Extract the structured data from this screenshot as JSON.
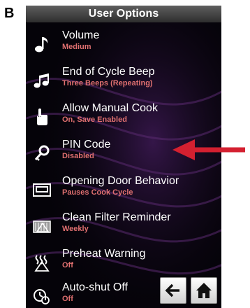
{
  "panel": {
    "letter": "B"
  },
  "header": {
    "title": "User Options"
  },
  "options": [
    {
      "label": "Volume",
      "value": "Medium",
      "icon": "music-note-icon"
    },
    {
      "label": "End of Cycle Beep",
      "value": "Three Beeps (Repeating)",
      "icon": "double-note-icon"
    },
    {
      "label": "Allow Manual Cook",
      "value": "On, Save Enabled",
      "icon": "hand-pointer-icon"
    },
    {
      "label": "PIN Code",
      "value": "Disabled",
      "icon": "key-icon"
    },
    {
      "label": "Opening Door Behavior",
      "value": "Pauses Cook Cycle",
      "icon": "oven-door-icon"
    },
    {
      "label": "Clean Filter Reminder",
      "value": "Weekly",
      "icon": "filter-icon"
    },
    {
      "label": "Preheat Warning",
      "value": "Off",
      "icon": "heat-warning-icon"
    },
    {
      "label": "Auto-shut Off",
      "value": "Off",
      "icon": "auto-shutoff-icon"
    }
  ],
  "nav": {
    "back_icon": "back-arrow-icon",
    "home_icon": "home-icon"
  },
  "colors": {
    "value_text": "#e07070",
    "annotation_arrow": "#d42030",
    "screen_bg": "#050309"
  }
}
